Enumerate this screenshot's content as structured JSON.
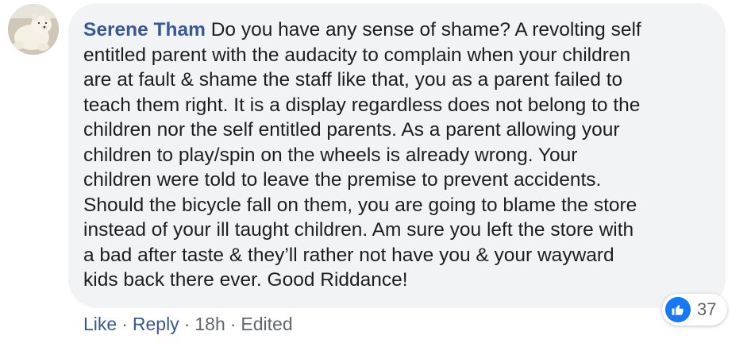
{
  "comment": {
    "author": "Serene Tham",
    "text_lines": [
      "Do you have any sense of shame? A revolting self",
      "entitled parent with the audacity to complain when your children",
      "are at fault & shame the staff like that, you as a parent failed to",
      "teach them right. It is a display regardless does not belong to the",
      "children nor the self entitled parents. As a parent allowing your",
      "children to play/spin on the wheels is already wrong. Your",
      "children were told to leave the premise to prevent accidents.",
      "Should the bicycle fall on them, you are going to blame the store",
      "instead of your ill taught children. Am sure you left the store with",
      "a bad after taste & they’ll rather not have you & your wayward",
      "kids back there ever. Good Riddance!"
    ],
    "reaction_count": "37",
    "reaction_icon": "like-thumb-icon",
    "actions": {
      "like_label": "Like",
      "reply_label": "Reply",
      "separator": "·",
      "time": "18h",
      "edited_label": "Edited"
    }
  },
  "colors": {
    "bubble": "#f2f3f5",
    "author": "#385898",
    "text": "#1c1e21",
    "meta": "#65676b",
    "like_blue": "#1877f2"
  }
}
